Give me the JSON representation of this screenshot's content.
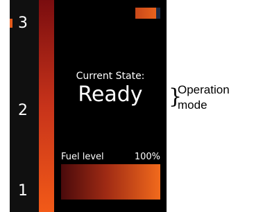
{
  "scale": {
    "levels": [
      "3",
      "2",
      "1"
    ],
    "active_level": "3"
  },
  "status": {
    "label": "Current State:",
    "value": "Ready"
  },
  "fuel": {
    "label": "Fuel level",
    "value_text": "100%",
    "fraction": 1.0
  },
  "annotation": {
    "text": "Operation mode"
  },
  "colors": {
    "accent": "#e35a1c",
    "panel_bg": "#000000"
  }
}
